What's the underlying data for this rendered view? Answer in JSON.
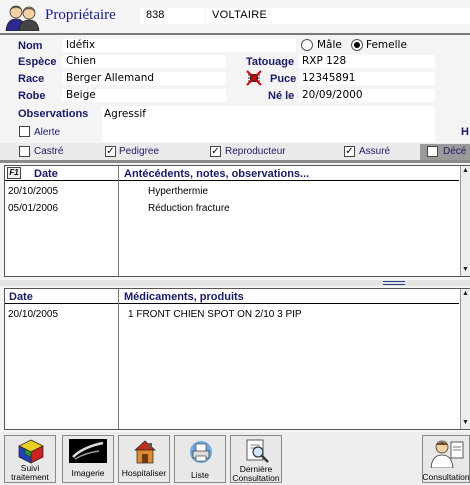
{
  "owner": {
    "label": "Propriétaire",
    "number": "838",
    "name": "VOLTAIRE"
  },
  "animal": {
    "nom_label": "Nom",
    "nom": "Idéfix",
    "sexe_options": [
      "Mâle",
      "Femelle"
    ],
    "sexe_selected": "Femelle",
    "espece_label": "Espèce",
    "espece": "Chien",
    "tatouage_label": "Tatouage",
    "tatouage": "RXP 128",
    "race_label": "Race",
    "race": "Berger Allemand",
    "puce_label": "Puce",
    "puce": "12345891",
    "robe_label": "Robe",
    "robe": "Beige",
    "ne_le_label": "Né le",
    "ne_le": "20/09/2000",
    "observations_label": "Observations",
    "observations": "Agressif",
    "alerte_label": "Alerte",
    "alerte": false,
    "cut_label": "H",
    "flags": [
      {
        "label": "Castré",
        "checked": false
      },
      {
        "label": "Pedigree",
        "checked": true
      },
      {
        "label": "Reproducteur",
        "checked": true
      },
      {
        "label": "Assuré",
        "checked": true
      },
      {
        "label": "Décé",
        "checked": false
      }
    ]
  },
  "history": {
    "f1_label": "F1",
    "col_date": "Date",
    "col_notes": "Antécédents, notes, observations...",
    "rows": [
      {
        "date": "20/10/2005",
        "note": "Hyperthermie"
      },
      {
        "date": "05/01/2006",
        "note": "Réduction fracture"
      }
    ]
  },
  "medications": {
    "col_date": "Date",
    "col_products": "Médicaments, produits",
    "rows": [
      {
        "date": "20/10/2005",
        "product": "1 FRONT CHIEN SPOT ON 2/10 3 PIP"
      }
    ]
  },
  "toolbar": {
    "suivi_l1": "Suivi",
    "suivi_l2": "traitement",
    "imagerie": "Imagerie",
    "hospitaliser": "Hospitaliser",
    "liste": "Liste",
    "derniere_l1": "Dernière",
    "derniere_l2": "Consultation",
    "consultation": "Consultation"
  }
}
